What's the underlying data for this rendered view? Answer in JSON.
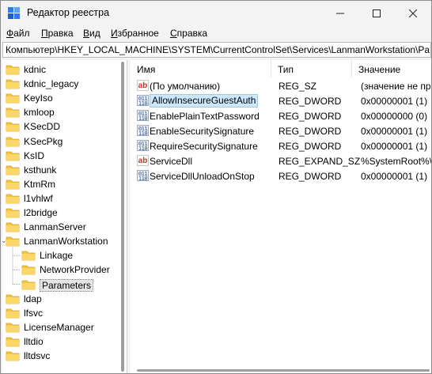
{
  "window": {
    "title": "Редактор реестра",
    "controls": {
      "minimize_icon": "minimize-icon",
      "maximize_icon": "maximize-icon",
      "close_icon": "close-icon"
    }
  },
  "menu": {
    "items": [
      {
        "label": "Файл"
      },
      {
        "label": "Правка"
      },
      {
        "label": "Вид"
      },
      {
        "label": "Избранное"
      },
      {
        "label": "Справка"
      }
    ]
  },
  "address": {
    "path": "Компьютер\\HKEY_LOCAL_MACHINE\\SYSTEM\\CurrentControlSet\\Services\\LanmanWorkstation\\Para"
  },
  "tree": {
    "items": [
      {
        "label": "kdnic",
        "level": 0,
        "selected": false,
        "expanded": false
      },
      {
        "label": "kdnic_legacy",
        "level": 0,
        "selected": false,
        "expanded": false
      },
      {
        "label": "KeyIso",
        "level": 0,
        "selected": false,
        "expanded": false
      },
      {
        "label": "kmloop",
        "level": 0,
        "selected": false,
        "expanded": false
      },
      {
        "label": "KSecDD",
        "level": 0,
        "selected": false,
        "expanded": false
      },
      {
        "label": "KSecPkg",
        "level": 0,
        "selected": false,
        "expanded": false
      },
      {
        "label": "KsID",
        "level": 0,
        "selected": false,
        "expanded": false
      },
      {
        "label": "ksthunk",
        "level": 0,
        "selected": false,
        "expanded": false
      },
      {
        "label": "KtmRm",
        "level": 0,
        "selected": false,
        "expanded": false
      },
      {
        "label": "l1vhlwf",
        "level": 0,
        "selected": false,
        "expanded": false
      },
      {
        "label": "l2bridge",
        "level": 0,
        "selected": false,
        "expanded": false
      },
      {
        "label": "LanmanServer",
        "level": 0,
        "selected": false,
        "expanded": false
      },
      {
        "label": "LanmanWorkstation",
        "level": 0,
        "selected": false,
        "expanded": true
      },
      {
        "label": "Linkage",
        "level": 1,
        "selected": false,
        "expanded": false
      },
      {
        "label": "NetworkProvider",
        "level": 1,
        "selected": false,
        "expanded": false
      },
      {
        "label": "Parameters",
        "level": 1,
        "selected": true,
        "expanded": false
      },
      {
        "label": "ldap",
        "level": 0,
        "selected": false,
        "expanded": false
      },
      {
        "label": "lfsvc",
        "level": 0,
        "selected": false,
        "expanded": false
      },
      {
        "label": "LicenseManager",
        "level": 0,
        "selected": false,
        "expanded": false
      },
      {
        "label": "lltdio",
        "level": 0,
        "selected": false,
        "expanded": false
      },
      {
        "label": "lltdsvc",
        "level": 0,
        "selected": false,
        "expanded": false
      }
    ]
  },
  "list": {
    "columns": {
      "name": "Имя",
      "type": "Тип",
      "value": "Значение"
    },
    "rows": [
      {
        "icon": "string-value-icon",
        "name": "(По умолчанию)",
        "type": "REG_SZ",
        "value": "(значение не пр",
        "selected": false
      },
      {
        "icon": "binary-value-icon",
        "name": "AllowInsecureGuestAuth",
        "type": "REG_DWORD",
        "value": "0x00000001 (1)",
        "selected": true
      },
      {
        "icon": "binary-value-icon",
        "name": "EnablePlainTextPassword",
        "type": "REG_DWORD",
        "value": "0x00000000 (0)",
        "selected": false
      },
      {
        "icon": "binary-value-icon",
        "name": "EnableSecuritySignature",
        "type": "REG_DWORD",
        "value": "0x00000001 (1)",
        "selected": false
      },
      {
        "icon": "binary-value-icon",
        "name": "RequireSecuritySignature",
        "type": "REG_DWORD",
        "value": "0x00000001 (1)",
        "selected": false
      },
      {
        "icon": "string-value-icon",
        "name": "ServiceDll",
        "type": "REG_EXPAND_SZ",
        "value": "%SystemRoot%\\",
        "selected": false
      },
      {
        "icon": "binary-value-icon",
        "name": "ServiceDllUnloadOnStop",
        "type": "REG_DWORD",
        "value": "0x00000001 (1)",
        "selected": false
      }
    ]
  },
  "colors": {
    "folder": "#f4c542",
    "folder_dark": "#d9a520",
    "selection": "#cce8ff",
    "app_icon": "#2b7de9"
  }
}
